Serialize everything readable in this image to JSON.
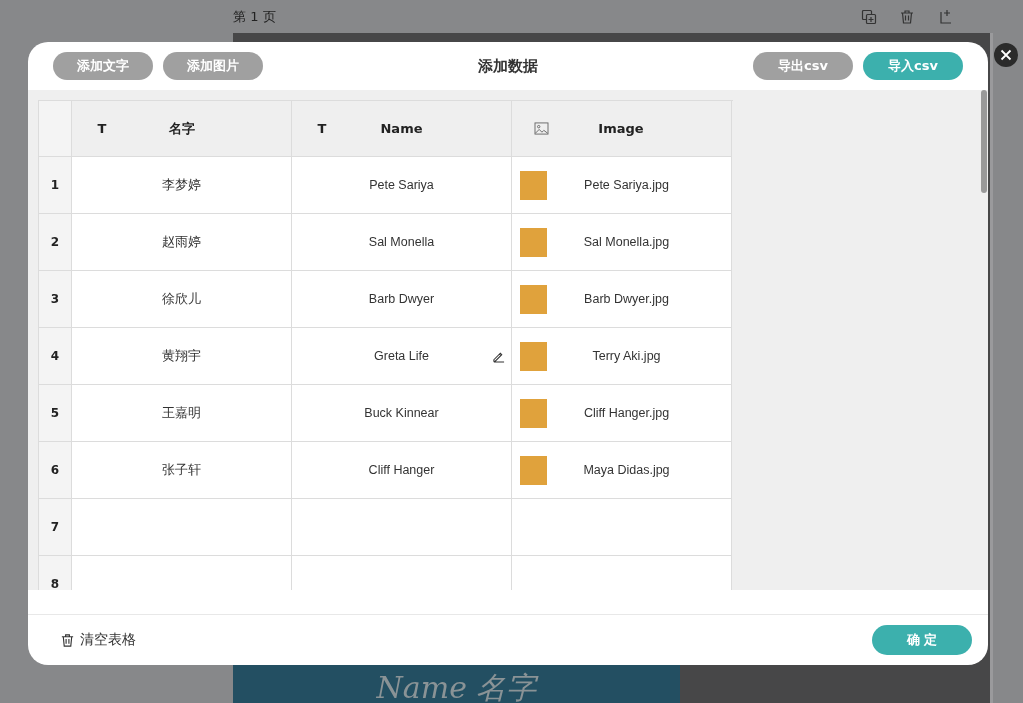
{
  "page": {
    "label": "第 1 页",
    "canvas_text": "Name 名字"
  },
  "dialog": {
    "title": "添加数据",
    "left_buttons": [
      "添加文字",
      "添加图片"
    ],
    "export_button": "导出csv",
    "import_button": "导入csv",
    "table": {
      "columns": [
        {
          "kind": "text",
          "type_mark": "T",
          "label": "名字"
        },
        {
          "kind": "text",
          "type_mark": "T",
          "label": "Name"
        },
        {
          "kind": "image",
          "label": "Image"
        }
      ],
      "rows": [
        {
          "number": "1",
          "cells": [
            "李梦婷",
            "Pete Sariya",
            "Pete Sariya.jpg"
          ],
          "edit_icon": false
        },
        {
          "number": "2",
          "cells": [
            "赵雨婷",
            "Sal Monella",
            "Sal Monella.jpg"
          ],
          "edit_icon": false
        },
        {
          "number": "3",
          "cells": [
            "徐欣儿",
            "Barb Dwyer",
            "Barb Dwyer.jpg"
          ],
          "edit_icon": false
        },
        {
          "number": "4",
          "cells": [
            "黄翔宇",
            "Greta Life",
            "Terry Aki.jpg"
          ],
          "edit_icon": true
        },
        {
          "number": "5",
          "cells": [
            "王嘉明",
            "Buck Kinnear",
            "Cliff Hanger.jpg"
          ],
          "edit_icon": false
        },
        {
          "number": "6",
          "cells": [
            "张子轩",
            "Cliff Hanger",
            "Maya Didas.jpg"
          ],
          "edit_icon": false
        },
        {
          "number": "7"
        },
        {
          "number": "8"
        }
      ]
    },
    "clear_button": "清空表格",
    "confirm_button": "确 定"
  }
}
